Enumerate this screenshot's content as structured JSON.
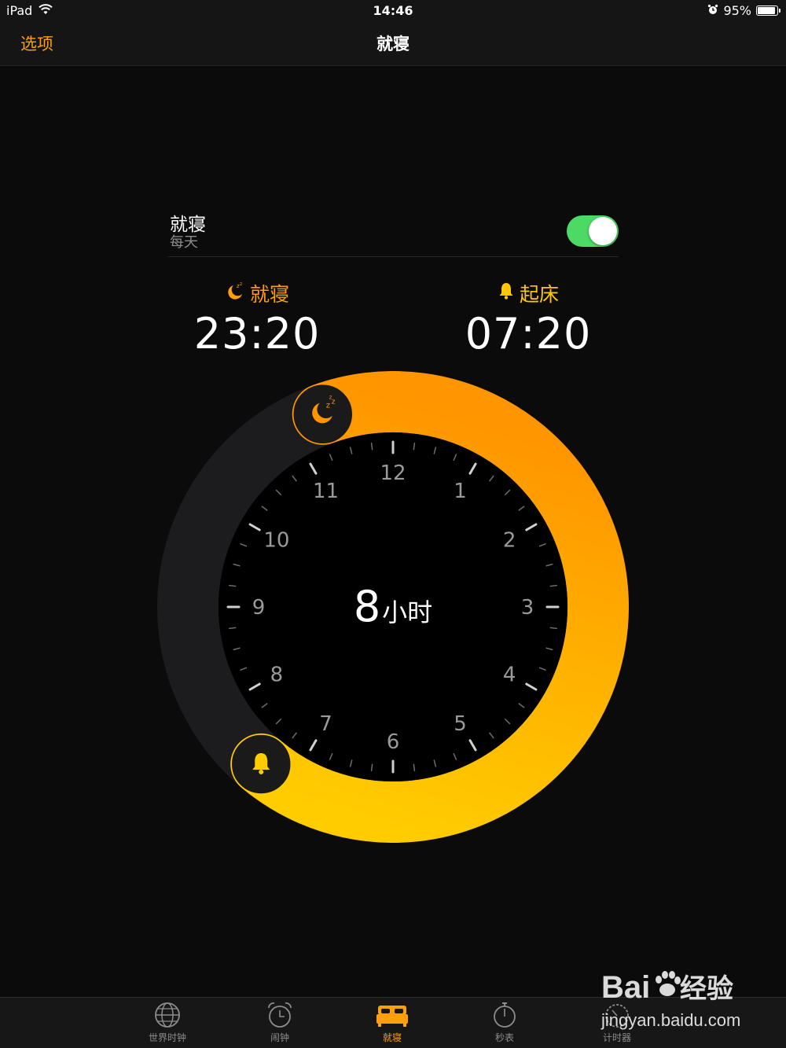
{
  "status_bar": {
    "device": "iPad",
    "time": "14:46",
    "battery": "95%",
    "battery_level": 0.95
  },
  "nav": {
    "left_button": "选项",
    "title": "就寝"
  },
  "bedtime_row": {
    "title": "就寝",
    "subtitle": "每天",
    "toggle_on": true
  },
  "bedtime": {
    "label": "就寝",
    "time": "23:20"
  },
  "wake": {
    "label": "起床",
    "time": "07:20"
  },
  "clock": {
    "duration_number": "8",
    "duration_unit": "小时",
    "hour_labels": [
      "12",
      "1",
      "2",
      "3",
      "4",
      "5",
      "6",
      "7",
      "8",
      "9",
      "10",
      "11"
    ],
    "sleep_start": "23:20",
    "sleep_end": "07:20",
    "colors": {
      "start": "#ff9500",
      "end": "#ffcc00",
      "track": "#1c1c1e"
    }
  },
  "tabs": [
    {
      "label": "世界时钟",
      "icon": "globe-icon"
    },
    {
      "label": "闹钟",
      "icon": "alarm-clock-icon"
    },
    {
      "label": "就寝",
      "icon": "bed-icon",
      "active": true
    },
    {
      "label": "秒表",
      "icon": "stopwatch-icon"
    },
    {
      "label": "计时器",
      "icon": "timer-icon"
    }
  ],
  "watermark": {
    "brand": "Bai du 经验",
    "url": "jingyan.baidu.com"
  },
  "colors": {
    "accent": "#ff9f0a",
    "toggle": "#4cd964",
    "background": "#0b0b0b"
  }
}
